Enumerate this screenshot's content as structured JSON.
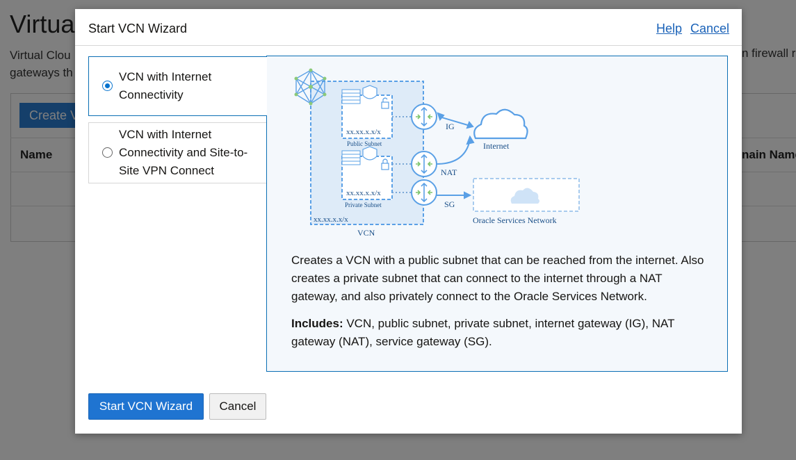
{
  "background": {
    "page_title": "Virtua",
    "description_line1": "Virtual Clou",
    "description_line2": "gateways th",
    "description_right": "n firewall r",
    "create_button": "Create V",
    "column_name": "Name",
    "column_domain": "nain Name"
  },
  "dialog": {
    "title": "Start VCN Wizard",
    "help_link": "Help",
    "cancel_link": "Cancel",
    "options": [
      {
        "label": "VCN with Internet Connectivity",
        "selected": true
      },
      {
        "label": "VCN with Internet Connectivity and Site-to-Site VPN Connect",
        "selected": false
      }
    ],
    "diagram": {
      "public_subnet_label": "Public Subnet",
      "private_subnet_label": "Private Subnet",
      "public_subnet_cidr": "xx.xx.x.x/x",
      "private_subnet_cidr": "xx.xx.x.x/x",
      "vcn_cidr": "xx.xx.x.x/x",
      "vcn_label": "VCN",
      "ig_label": "IG",
      "nat_label": "NAT",
      "sg_label": "SG",
      "internet_label": "Internet",
      "osn_label": "Oracle Services Network"
    },
    "description": "Creates a VCN with a public subnet that can be reached from the internet. Also creates a private subnet that can connect to the internet through a NAT gateway, and also privately connect to the Oracle Services Network.",
    "includes_label": "Includes:",
    "includes_text": " VCN, public subnet, private subnet, internet gateway (IG), NAT gateway (NAT), service gateway (SG).",
    "start_button": "Start VCN Wizard",
    "cancel_button": "Cancel"
  },
  "colors": {
    "accent": "#1f74d1",
    "link": "#1a62b8",
    "diagram_blue": "#5aa0e6",
    "panel_bg": "#f4f8fc"
  }
}
